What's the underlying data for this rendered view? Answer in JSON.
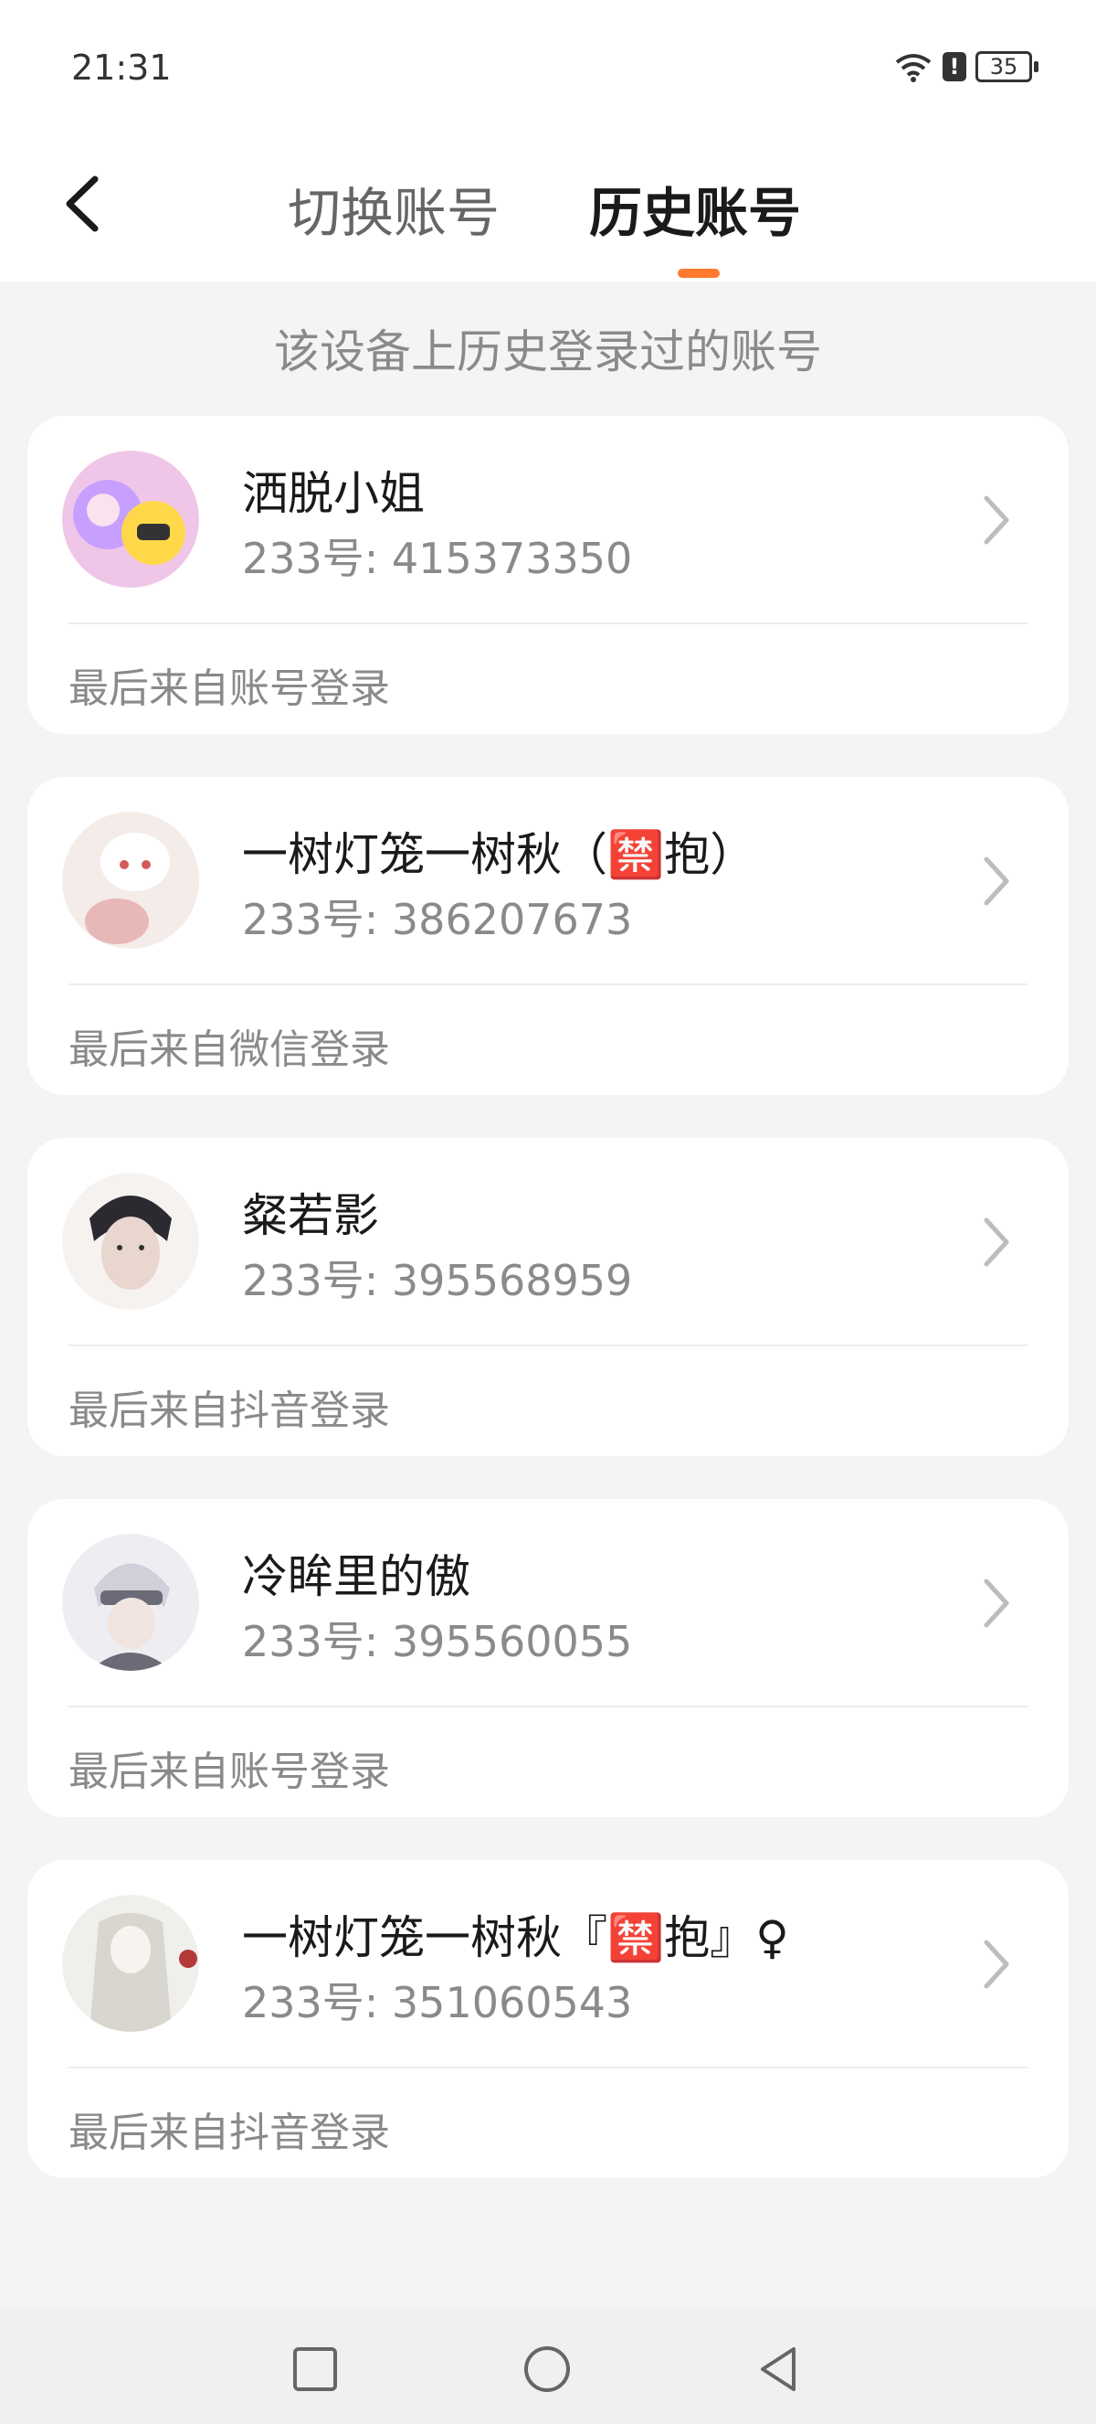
{
  "status": {
    "time": "21:31",
    "battery": "35",
    "alert": "!"
  },
  "tabs": {
    "switch_account": "切换账号",
    "history_account": "历史账号"
  },
  "subtitle": "该设备上历史登录过的账号",
  "accounts": [
    {
      "name": "洒脱小姐",
      "id": "233号: 415373350",
      "login": "最后来自账号登录",
      "avatar_colors": [
        "#f0c6e8",
        "#ffd84a",
        "#c7a0ff"
      ]
    },
    {
      "name": "一树灯笼一树秋（🈲抱）",
      "id": "233号: 386207673",
      "login": "最后来自微信登录",
      "avatar_colors": [
        "#f4ece8",
        "#e8b8b8",
        "#ffffff"
      ]
    },
    {
      "name": "粲若影",
      "id": "233号: 395568959",
      "login": "最后来自抖音登录",
      "avatar_colors": [
        "#f6f2f0",
        "#2a2a30",
        "#e9d6cf"
      ]
    },
    {
      "name": "冷眸里的傲",
      "id": "233号: 395560055",
      "login": "最后来自账号登录",
      "avatar_colors": [
        "#eeeef2",
        "#6b6b78",
        "#d0d0da"
      ]
    },
    {
      "name": "一树灯笼一树秋『🈲抱』♀",
      "id": "233号: 351060543",
      "login": "最后来自抖音登录",
      "avatar_colors": [
        "#efefec",
        "#d9d6cf",
        "#b43a3a"
      ]
    }
  ],
  "colors": {
    "accent": "#ff7a2e",
    "background": "#f4f4f4",
    "card": "#ffffff"
  }
}
